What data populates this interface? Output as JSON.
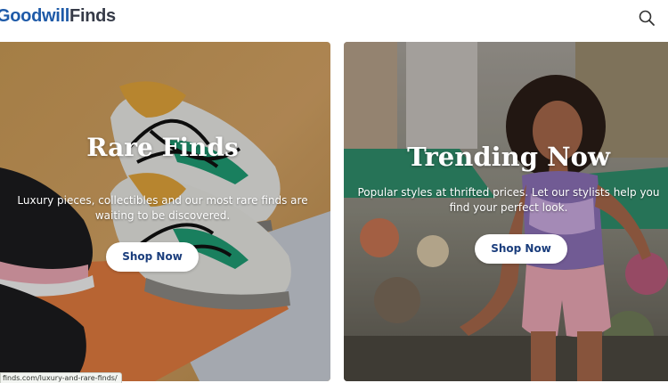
{
  "header": {
    "logo_primary": "Goodwill",
    "logo_secondary": "Finds",
    "search_icon": "search-icon"
  },
  "cards": [
    {
      "title": "Rare Finds",
      "description_line1": "Luxury pieces, collectibles and our most rare finds are",
      "description_line2": "waiting to be discovered.",
      "button_label": "Shop Now",
      "image": "sneakers-photo"
    },
    {
      "title": "Trending Now",
      "description_line1": "Popular styles at thrifted prices. Let our stylists help you",
      "description_line2": "find your perfect look.",
      "button_label": "Shop Now",
      "image": "woman-in-market-photo"
    }
  ],
  "status_bar": {
    "url": "finds.com/luxury-and-rare-finds/"
  },
  "colors": {
    "logo_blue": "#1e5aa8",
    "logo_dark": "#353a47",
    "button_text": "#1a3d7c"
  }
}
